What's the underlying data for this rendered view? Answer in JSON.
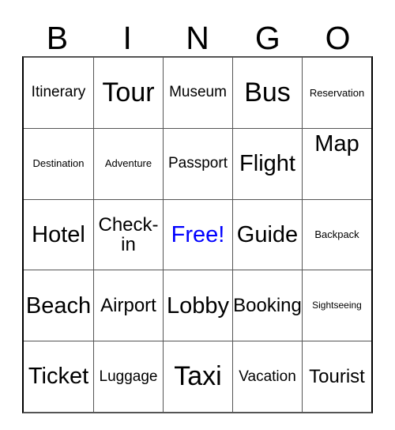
{
  "card": {
    "title_letters": [
      "B",
      "I",
      "N",
      "G",
      "O"
    ],
    "free_space_color": "#0000FF",
    "grid": [
      [
        {
          "text": "Itinerary",
          "size": "s-sm",
          "free": false
        },
        {
          "text": "Tour",
          "size": "s-xl",
          "free": false
        },
        {
          "text": "Museum",
          "size": "s-sm",
          "free": false
        },
        {
          "text": "Bus",
          "size": "s-xl",
          "free": false
        },
        {
          "text": "Reservation",
          "size": "s-xs",
          "free": false
        }
      ],
      [
        {
          "text": "Destination",
          "size": "s-xs",
          "free": false
        },
        {
          "text": "Adventure",
          "size": "s-xs",
          "free": false
        },
        {
          "text": "Passport",
          "size": "s-sm",
          "free": false
        },
        {
          "text": "Flight",
          "size": "s-lg",
          "free": false
        },
        {
          "text": "Map",
          "size": "s-lg",
          "free": false
        }
      ],
      [
        {
          "text": "Hotel",
          "size": "s-lg",
          "free": false
        },
        {
          "text": "Check-in",
          "size": "s-md",
          "free": false
        },
        {
          "text": "Free!",
          "size": "s-lg",
          "free": true
        },
        {
          "text": "Guide",
          "size": "s-lg",
          "free": false
        },
        {
          "text": "Backpack",
          "size": "s-xs",
          "free": false
        }
      ],
      [
        {
          "text": "Beach",
          "size": "s-lg",
          "free": false
        },
        {
          "text": "Airport",
          "size": "s-md",
          "free": false
        },
        {
          "text": "Lobby",
          "size": "s-lg",
          "free": false
        },
        {
          "text": "Booking",
          "size": "s-md",
          "free": false
        },
        {
          "text": "Sightseeing",
          "size": "s-xxs",
          "free": false
        }
      ],
      [
        {
          "text": "Ticket",
          "size": "s-lg",
          "free": false
        },
        {
          "text": "Luggage",
          "size": "s-sm",
          "free": false
        },
        {
          "text": "Taxi",
          "size": "s-xl",
          "free": false
        },
        {
          "text": "Vacation",
          "size": "s-sm",
          "free": false
        },
        {
          "text": "Tourist",
          "size": "s-md",
          "free": false
        }
      ]
    ]
  }
}
